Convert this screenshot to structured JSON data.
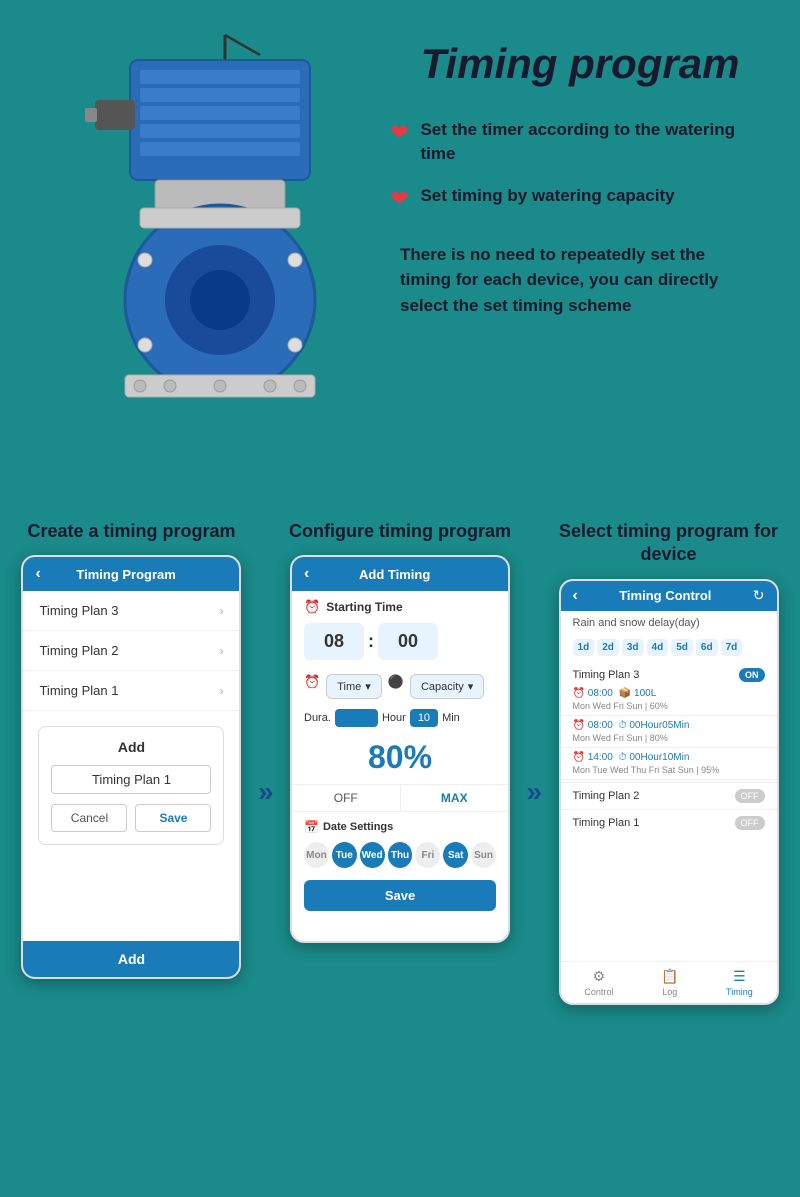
{
  "page": {
    "title": "Timing program",
    "bg_color": "#1a8a8a"
  },
  "features": {
    "item1": "Set the timer according to the watering time",
    "item2": "Set timing by watering capacity",
    "description": "There is no need to repeatedly set the timing for each device, you can directly select the set timing scheme"
  },
  "steps": {
    "step1": {
      "title": "Create a timing program",
      "phone_header": "Timing Program",
      "list_items": [
        "Timing Plan 3",
        "Timing Plan 2",
        "Timing Plan 1"
      ],
      "dialog_title": "Add",
      "dialog_input": "Timing Plan 1",
      "btn_cancel": "Cancel",
      "btn_save": "Save",
      "footer_add": "Add"
    },
    "step2": {
      "title": "Configure timing program",
      "phone_header": "Add Timing",
      "starting_time_label": "Starting Time",
      "time_hour": "08",
      "time_min": "00",
      "dropdown1": "Time",
      "dropdown2": "Capacity",
      "dura_label": "Dura.",
      "hour_label": "Hour",
      "min_num": "10",
      "min_label": "Min",
      "percentage": "80%",
      "btn_off": "OFF",
      "btn_max": "MAX",
      "date_label": "Date Settings",
      "days": [
        "Mon",
        "Tue",
        "Wed",
        "Thu",
        "Fri",
        "Sat",
        "Sun"
      ],
      "days_active": [
        false,
        true,
        true,
        true,
        false,
        true,
        false
      ],
      "btn_save": "Save"
    },
    "step3": {
      "title": "Select timing program for device",
      "phone_header": "Timing Control",
      "rain_delay": "Rain and snow delay(day)",
      "day_tabs": [
        "1d",
        "2d",
        "3d",
        "4d",
        "5d",
        "6d",
        "7d"
      ],
      "plan3_label": "Timing Plan 3",
      "plan3_toggle": "ON",
      "schedule": [
        {
          "time": "08:00",
          "detail": "100L",
          "meta": "Mon Wed Fri Sun | 60%"
        },
        {
          "time": "08:00",
          "detail": "00Hour05Min",
          "meta": "Mon Wed Fri Sun | 80%"
        },
        {
          "time": "14:00",
          "detail": "00Hour10Min",
          "meta": "Mon Tue Wed Thu Fri Sat Sun | 95%"
        }
      ],
      "plan2_label": "Timing Plan 2",
      "plan2_toggle": "OFF",
      "plan1_label": "Timing Plan 1",
      "plan1_toggle": "OFF",
      "footer_tabs": [
        "Control",
        "Log",
        "Timing"
      ]
    }
  },
  "arrows": {
    "symbol": "»"
  }
}
